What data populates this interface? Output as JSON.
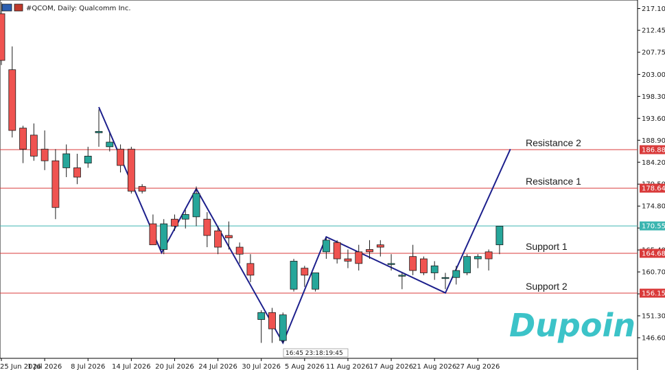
{
  "header": {
    "title": "#QCOM, Daily: Qualcomm Inc."
  },
  "brand": {
    "name": "Dupoin",
    "color": "#3cc3c8"
  },
  "timer": {
    "text": "16:45 23:18:19:45"
  },
  "colors": {
    "bull": "#26a69a",
    "bear": "#ef5350",
    "level_line": "#d93a3a",
    "current_line": "#3bb5b0",
    "zigzag": "#1c1f8c"
  },
  "chart_data": {
    "type": "candlestick",
    "symbol": "#QCOM",
    "timeframe": "Daily",
    "title": "#QCOM, Daily: Qualcomm Inc.",
    "ylim": [
      143.0,
      218.5
    ],
    "y_ticks": [
      "217.10",
      "212.45",
      "207.75",
      "203.00",
      "198.30",
      "193.60",
      "188.90",
      "184.20",
      "179.50",
      "174.80",
      "170.10",
      "165.40",
      "160.70",
      "156.00",
      "151.30",
      "146.60"
    ],
    "x_ticks": [
      "25 Jun 2026",
      "1 Jul 2026",
      "8 Jul 2026",
      "14 Jul 2026",
      "20 Jul 2026",
      "24 Jul 2026",
      "30 Jul 2026",
      "5 Aug 2026",
      "11 Aug 2026",
      "17 Aug 2026",
      "21 Aug 2026",
      "27 Aug 2026"
    ],
    "candles": [
      {
        "o": 216.0,
        "h": 218.5,
        "l": 205.0,
        "c": 206.0
      },
      {
        "o": 204.0,
        "h": 209.0,
        "l": 189.5,
        "c": 191.0
      },
      {
        "o": 191.5,
        "h": 192.0,
        "l": 184.0,
        "c": 187.0
      },
      {
        "o": 190.0,
        "h": 192.5,
        "l": 184.5,
        "c": 185.5
      },
      {
        "o": 187.0,
        "h": 191.0,
        "l": 182.5,
        "c": 184.5
      },
      {
        "o": 184.5,
        "h": 187.0,
        "l": 172.0,
        "c": 174.5
      },
      {
        "o": 183.0,
        "h": 188.0,
        "l": 181.0,
        "c": 186.0
      },
      {
        "o": 183.0,
        "h": 186.0,
        "l": 179.5,
        "c": 181.0
      },
      {
        "o": 184.0,
        "h": 187.5,
        "l": 183.0,
        "c": 185.5
      },
      {
        "o": 190.5,
        "h": 195.5,
        "l": 187.5,
        "c": 190.8
      },
      {
        "o": 187.5,
        "h": 190.5,
        "l": 186.5,
        "c": 188.5
      },
      {
        "o": 187.0,
        "h": 188.0,
        "l": 182.0,
        "c": 183.5
      },
      {
        "o": 187.0,
        "h": 187.5,
        "l": 177.5,
        "c": 178.0
      },
      {
        "o": 179.0,
        "h": 179.5,
        "l": 177.5,
        "c": 178.0
      },
      {
        "o": 171.0,
        "h": 173.0,
        "l": 166.5,
        "c": 166.5
      },
      {
        "o": 165.5,
        "h": 172.0,
        "l": 164.5,
        "c": 171.0
      },
      {
        "o": 172.0,
        "h": 173.0,
        "l": 169.5,
        "c": 170.5
      },
      {
        "o": 172.0,
        "h": 174.0,
        "l": 170.0,
        "c": 173.0
      },
      {
        "o": 172.5,
        "h": 179.0,
        "l": 170.5,
        "c": 177.5
      },
      {
        "o": 172.0,
        "h": 173.5,
        "l": 166.0,
        "c": 168.5
      },
      {
        "o": 169.5,
        "h": 170.5,
        "l": 164.5,
        "c": 166.0
      },
      {
        "o": 168.5,
        "h": 171.5,
        "l": 165.5,
        "c": 168.0
      },
      {
        "o": 166.0,
        "h": 167.0,
        "l": 162.5,
        "c": 164.5
      },
      {
        "o": 162.5,
        "h": 164.5,
        "l": 158.5,
        "c": 160.0
      },
      {
        "o": 150.5,
        "h": 152.5,
        "l": 145.5,
        "c": 152.0
      },
      {
        "o": 152.0,
        "h": 153.0,
        "l": 145.5,
        "c": 148.5
      },
      {
        "o": 146.0,
        "h": 152.0,
        "l": 145.5,
        "c": 151.5
      },
      {
        "o": 157.0,
        "h": 163.5,
        "l": 156.5,
        "c": 163.0
      },
      {
        "o": 161.5,
        "h": 162.0,
        "l": 157.5,
        "c": 160.0
      },
      {
        "o": 157.0,
        "h": 160.5,
        "l": 156.5,
        "c": 160.5
      },
      {
        "o": 165.0,
        "h": 168.0,
        "l": 163.5,
        "c": 167.5
      },
      {
        "o": 167.0,
        "h": 167.5,
        "l": 162.5,
        "c": 163.5
      },
      {
        "o": 163.5,
        "h": 165.5,
        "l": 161.5,
        "c": 163.0
      },
      {
        "o": 165.0,
        "h": 166.5,
        "l": 161.0,
        "c": 162.5
      },
      {
        "o": 165.5,
        "h": 167.5,
        "l": 163.5,
        "c": 165.0
      },
      {
        "o": 166.5,
        "h": 167.5,
        "l": 164.0,
        "c": 166.0
      },
      {
        "o": 162.5,
        "h": 164.5,
        "l": 161.0,
        "c": 162.5
      },
      {
        "o": 160.0,
        "h": 160.5,
        "l": 157.0,
        "c": 160.0
      },
      {
        "o": 164.0,
        "h": 166.5,
        "l": 160.0,
        "c": 161.0
      },
      {
        "o": 163.5,
        "h": 164.0,
        "l": 160.0,
        "c": 160.5
      },
      {
        "o": 160.5,
        "h": 163.0,
        "l": 159.0,
        "c": 162.0
      },
      {
        "o": 159.5,
        "h": 160.5,
        "l": 157.0,
        "c": 159.5
      },
      {
        "o": 159.5,
        "h": 162.0,
        "l": 158.0,
        "c": 161.0
      },
      {
        "o": 160.5,
        "h": 164.5,
        "l": 160.0,
        "c": 164.0
      },
      {
        "o": 163.5,
        "h": 164.5,
        "l": 161.5,
        "c": 164.0
      },
      {
        "o": 165.0,
        "h": 165.5,
        "l": 161.0,
        "c": 163.5
      },
      {
        "o": 166.5,
        "h": 170.5,
        "l": 164.5,
        "c": 170.5
      }
    ],
    "levels": [
      {
        "name": "Resistance 2",
        "value": 186.88
      },
      {
        "name": "Resistance 1",
        "value": 178.64
      },
      {
        "name": "Support 1",
        "value": 164.68
      },
      {
        "name": "Support 2",
        "value": 156.15
      }
    ],
    "current_price": {
      "value": 170.55,
      "label": "170.55"
    },
    "zigzag": [
      {
        "i": 9,
        "y": 196.0
      },
      {
        "i": 14.8,
        "y": 164.8
      },
      {
        "i": 18,
        "y": 178.5
      },
      {
        "i": 26,
        "y": 145.5
      },
      {
        "i": 30,
        "y": 168.2
      },
      {
        "i": 41,
        "y": 156.2
      },
      {
        "i": 47,
        "y": 187.0
      }
    ]
  }
}
